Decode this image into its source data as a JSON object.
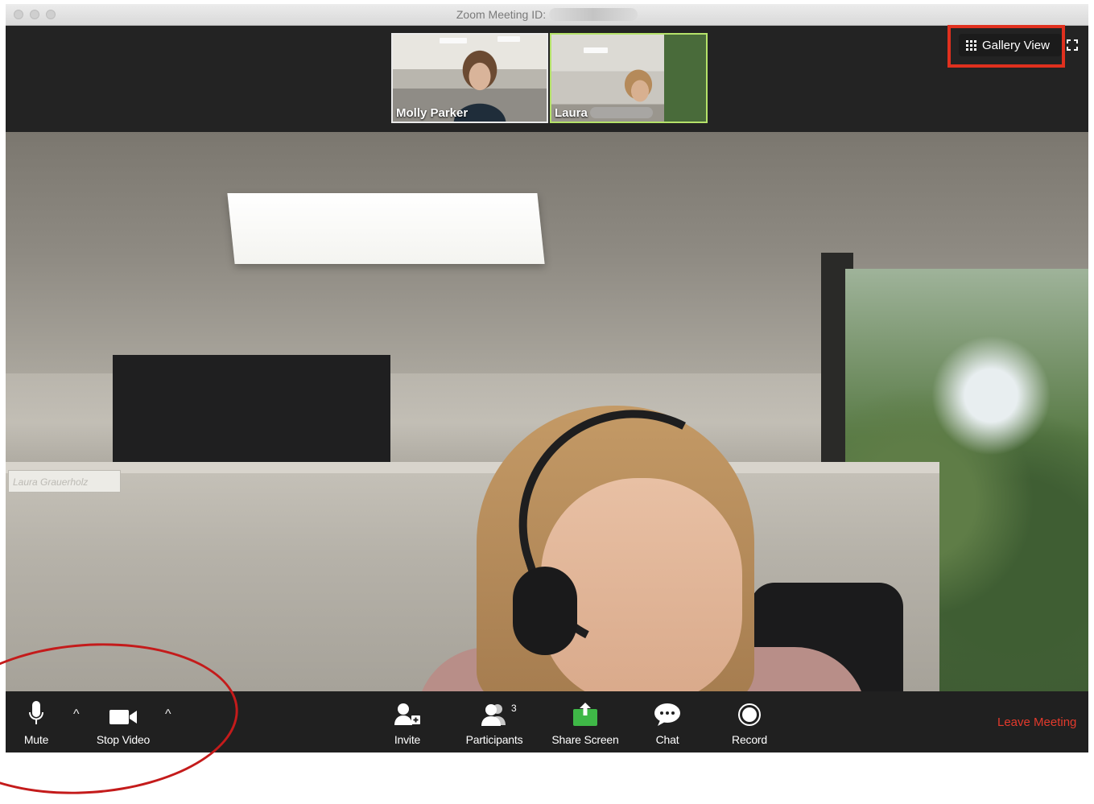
{
  "window": {
    "title_prefix": "Zoom Meeting ID:",
    "accent_colors": {
      "highlight_red": "#e0301e",
      "active_speaker_border": "#b5e26a",
      "leave_red": "#e33a2c",
      "share_green": "#3fb847"
    }
  },
  "thumbnails": [
    {
      "name": "Molly Parker",
      "active": false
    },
    {
      "name": "Laura",
      "active": true
    }
  ],
  "view_controls": {
    "gallery_view_label": "Gallery View",
    "gallery_icon": "grid-icon",
    "fullscreen_icon": "fullscreen-icon"
  },
  "main_video": {
    "nameplate_text": "Laura Grauerholz"
  },
  "toolbar": {
    "mute_label": "Mute",
    "stop_video_label": "Stop Video",
    "invite_label": "Invite",
    "participants_label": "Participants",
    "participants_count": "3",
    "share_screen_label": "Share Screen",
    "chat_label": "Chat",
    "record_label": "Record",
    "leave_label": "Leave Meeting",
    "caret_glyph": "^"
  }
}
